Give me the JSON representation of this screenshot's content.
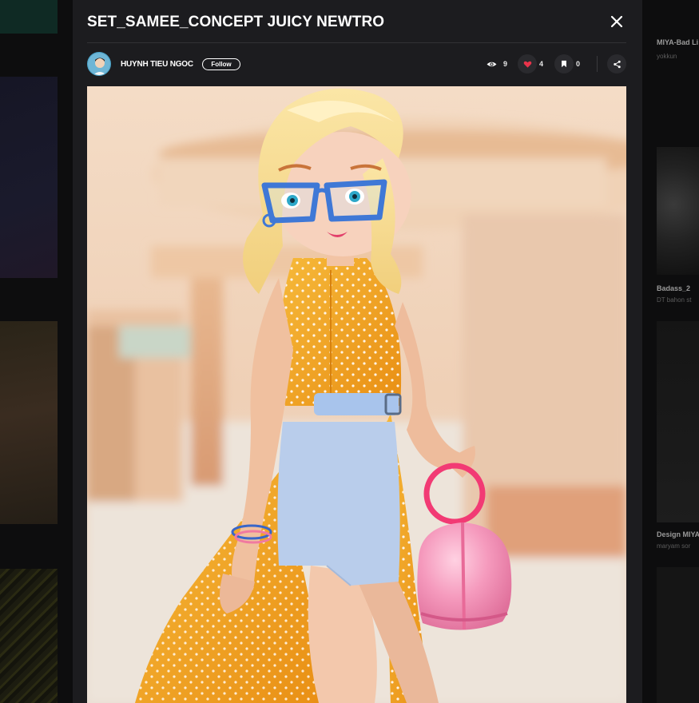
{
  "modal": {
    "title": "SET_SAMEE_CONCEPT JUICY NEWTRO",
    "close_icon": "close-icon"
  },
  "author": {
    "name": "HUYNH TIEU NGOC",
    "follow_label": "Follow"
  },
  "stats": {
    "views": "9",
    "likes": "4",
    "saves": "0"
  },
  "icons": {
    "views": "eye-icon",
    "likes": "heart-icon",
    "saves": "bookmark-icon",
    "share": "share-icon"
  },
  "colors": {
    "accent_heart": "#e8334a",
    "modal_bg": "#1c1c1f",
    "page_bg": "#0d0d0e"
  },
  "background_cards": [
    {
      "title": "MIYA-Bad Li",
      "subtitle": "yokkun"
    },
    {
      "title": "Badass_2",
      "subtitle": "DT bahon st"
    },
    {
      "title": "Design MIYA",
      "subtitle": "maryam sor"
    }
  ]
}
